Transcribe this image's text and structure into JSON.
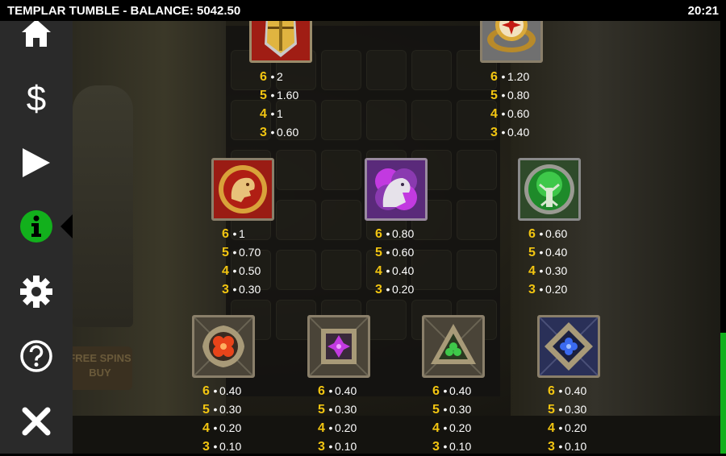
{
  "header": {
    "title": "TEMPLAR TUMBLE - BALANCE: 5042.50",
    "clock": "20:21"
  },
  "sidebar": {
    "items": [
      {
        "name": "home-icon"
      },
      {
        "name": "dollar-icon"
      },
      {
        "name": "play-icon"
      },
      {
        "name": "info-icon",
        "active": true
      },
      {
        "name": "gear-icon"
      },
      {
        "name": "help-icon"
      },
      {
        "name": "close-icon"
      }
    ]
  },
  "background": {
    "buy_label": "FREE SPINS\nBUY"
  },
  "paytable": {
    "symbols": [
      {
        "name": "helmet",
        "pays": [
          {
            "n": "6",
            "v": "2"
          },
          {
            "n": "5",
            "v": "1.60"
          },
          {
            "n": "4",
            "v": "1"
          },
          {
            "n": "3",
            "v": "0.60"
          }
        ]
      },
      {
        "name": "ring",
        "pays": [
          {
            "n": "6",
            "v": "1.20"
          },
          {
            "n": "5",
            "v": "0.80"
          },
          {
            "n": "4",
            "v": "0.60"
          },
          {
            "n": "3",
            "v": "0.40"
          }
        ]
      },
      {
        "name": "lion",
        "pays": [
          {
            "n": "6",
            "v": "1"
          },
          {
            "n": "5",
            "v": "0.70"
          },
          {
            "n": "4",
            "v": "0.50"
          },
          {
            "n": "3",
            "v": "0.30"
          }
        ]
      },
      {
        "name": "horse",
        "pays": [
          {
            "n": "6",
            "v": "0.80"
          },
          {
            "n": "5",
            "v": "0.60"
          },
          {
            "n": "4",
            "v": "0.40"
          },
          {
            "n": "3",
            "v": "0.20"
          }
        ]
      },
      {
        "name": "tree",
        "pays": [
          {
            "n": "6",
            "v": "0.60"
          },
          {
            "n": "5",
            "v": "0.40"
          },
          {
            "n": "4",
            "v": "0.30"
          },
          {
            "n": "3",
            "v": "0.20"
          }
        ]
      },
      {
        "name": "red-gem",
        "pays": [
          {
            "n": "6",
            "v": "0.40"
          },
          {
            "n": "5",
            "v": "0.30"
          },
          {
            "n": "4",
            "v": "0.20"
          },
          {
            "n": "3",
            "v": "0.10"
          }
        ]
      },
      {
        "name": "purple-gem",
        "pays": [
          {
            "n": "6",
            "v": "0.40"
          },
          {
            "n": "5",
            "v": "0.30"
          },
          {
            "n": "4",
            "v": "0.20"
          },
          {
            "n": "3",
            "v": "0.10"
          }
        ]
      },
      {
        "name": "green-gem",
        "pays": [
          {
            "n": "6",
            "v": "0.40"
          },
          {
            "n": "5",
            "v": "0.30"
          },
          {
            "n": "4",
            "v": "0.20"
          },
          {
            "n": "3",
            "v": "0.10"
          }
        ]
      },
      {
        "name": "blue-gem",
        "pays": [
          {
            "n": "6",
            "v": "0.40"
          },
          {
            "n": "5",
            "v": "0.30"
          },
          {
            "n": "4",
            "v": "0.20"
          },
          {
            "n": "3",
            "v": "0.10"
          }
        ]
      }
    ]
  },
  "colors": {
    "accent_yellow": "#f2c511",
    "active_green": "#12b01c",
    "sidebar": "#2a2a2a"
  }
}
